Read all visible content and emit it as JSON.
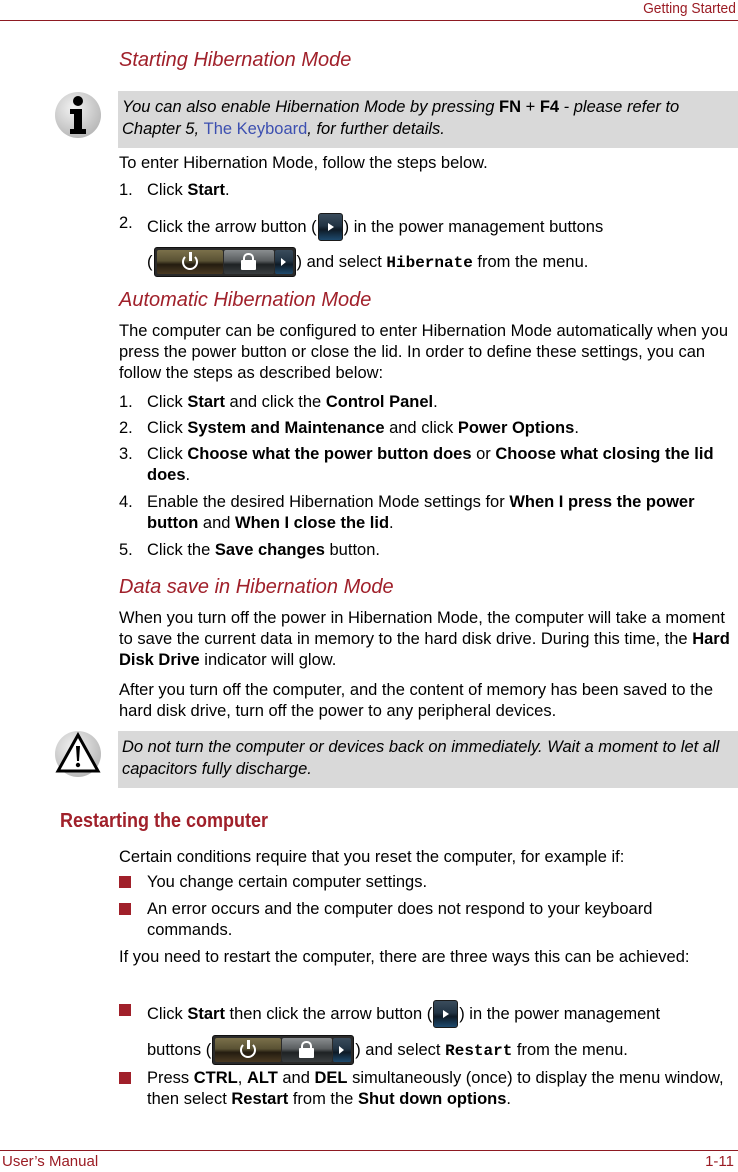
{
  "header": {
    "chapter": "Getting Started"
  },
  "footer": {
    "left": "User’s Manual",
    "right": "1-11"
  },
  "starting": {
    "heading": "Starting Hibernation Mode",
    "note": {
      "icon": "info-icon",
      "t1": "You can also enable Hibernation Mode by pressing ",
      "fn": "FN",
      "plus": " + ",
      "f4": "F4",
      "t2": " - please refer to Chapter 5, ",
      "link": "The Keyboard",
      "t3": ", for further details."
    },
    "intro": "To enter Hibernation Mode, follow the steps below.",
    "steps": [
      {
        "num": "1.",
        "a": "Click ",
        "b": "Start",
        "c": "."
      },
      {
        "num": "2.",
        "a": "Click the arrow button (",
        "b": ") in the power management buttons",
        "c": "(",
        "d": ") and select ",
        "code": "Hibernate",
        "e": " from the menu."
      }
    ]
  },
  "automatic": {
    "heading": "Automatic Hibernation Mode",
    "intro": "The computer can be configured to enter Hibernation Mode automatically when you press the power button or close the lid. In order to define these settings, you can follow the steps as described below:",
    "steps": [
      {
        "num": "1.",
        "parts": [
          "Click ",
          "Start",
          " and click the ",
          "Control Panel",
          "."
        ]
      },
      {
        "num": "2.",
        "parts": [
          "Click ",
          "System and Maintenance",
          " and click ",
          "Power Options",
          "."
        ]
      },
      {
        "num": "3.",
        "parts": [
          "Click ",
          "Choose what the power button does",
          " or ",
          "Choose what closing the lid does",
          "."
        ]
      },
      {
        "num": "4.",
        "parts": [
          "Enable the desired Hibernation Mode settings for ",
          "When I press the power button",
          " and ",
          "When I close the lid",
          "."
        ]
      },
      {
        "num": "5.",
        "parts": [
          "Click the ",
          "Save changes",
          " button."
        ]
      }
    ]
  },
  "datasave": {
    "heading": "Data save in Hibernation Mode",
    "p1a": "When you turn off the power in Hibernation Mode, the computer will take a moment to save the current data in memory to the hard disk drive. During this time, the ",
    "p1b": "Hard Disk Drive",
    "p1c": " indicator will glow.",
    "p2": "After you turn off the computer, and the content of memory has been saved to the hard disk drive, turn off the power to any peripheral devices.",
    "caution": {
      "icon": "warning-icon",
      "text": "Do not turn the computer or devices back on immediately. Wait a moment to let all capacitors fully discharge."
    }
  },
  "restarting": {
    "heading": "Restarting the computer",
    "intro": "Certain conditions require that you reset the computer, for example if:",
    "conditions": [
      "You change certain computer settings.",
      "An error occurs and the computer does not respond to your keyboard commands."
    ],
    "ways_intro": "If you need to restart the computer, there are three ways this can be achieved:",
    "way1": {
      "a": "Click ",
      "b": "Start",
      "c": " then click the arrow button (",
      "d": ") in the power management",
      "e": "buttons (",
      "f": ") and select ",
      "code": "Restart",
      "g": " from the menu."
    },
    "way2": {
      "a": "Press ",
      "b": "CTRL",
      "c": ", ",
      "d": "ALT",
      "e": " and ",
      "f": "DEL",
      "g": " simultaneously (once) to display the menu window, then select ",
      "h": "Restart",
      "i": " from the ",
      "j": "Shut down options",
      "k": "."
    }
  },
  "colors": {
    "accent": "#a0202a",
    "note_bg": "#d9d9d9",
    "link": "#3c4fb0"
  }
}
